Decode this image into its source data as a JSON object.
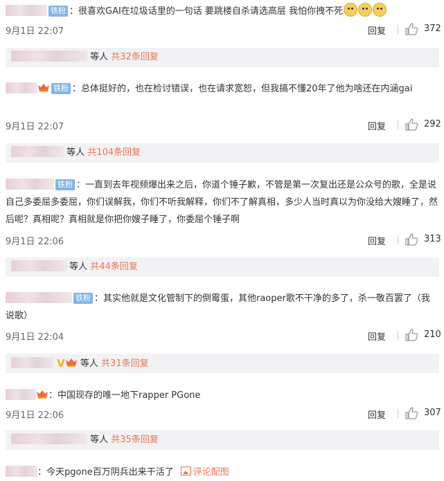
{
  "comments": [
    {
      "badge": "铁粉",
      "text": "：很喜欢GAI在垃圾话里的一句话 要跳楼自杀请选高层 我怕你拽不死",
      "time": "9月1日 22:07",
      "reply": "回复",
      "likes": "372",
      "emoji_icon": "doge-emoji-icon"
    },
    {
      "badge": "铁粉",
      "text": "：总体挺好的，也在检讨错误，也在请求宽恕，但我搞不懂20年了他为啥还在内涵gai",
      "time": "9月1日 22:07",
      "reply": "回复",
      "likes": "292"
    },
    {
      "badge": "铁粉",
      "text": "：一直到去年视频爆出来之后，你道个锤子歉，不管是第一次复出还是公众号的歌，全是说自己多委屈多委屈，你们误解我，你们不听我解释，你们不了解真相，多少人当时真以为你没给大嫂睡了，然后呢？真相呢？真相就是你把你嫂子睡了，你委屈个锤子啊",
      "time": "9月1日 22:06",
      "reply": "回复",
      "likes": "313"
    },
    {
      "badge": "铁粉",
      "text": "：其实他就是文化管制下的倒霉蛋，其他raoper歌不干净的多了，杀一敬百罢了（我说歌）",
      "time": "9月1日 22:04",
      "reply": "回复",
      "likes": "210"
    },
    {
      "text": "：中国现存的唯一地下rapper PGone",
      "time": "9月1日 22:06",
      "reply": "回复",
      "likes": "307"
    },
    {
      "text": "：今天pgone百万阴兵出来干活了",
      "pic_link": "评论配图"
    }
  ],
  "summaries": [
    {
      "suffix": "等人",
      "total": "共32条回复"
    },
    {
      "suffix": "等人",
      "total": "共104条回复"
    },
    {
      "suffix": "等人",
      "total": "共44条回复"
    },
    {
      "suffix": "等人",
      "total": "共31条回复",
      "verified": "V"
    },
    {
      "suffix": "等人",
      "total": "共35条回复"
    }
  ],
  "colors": {
    "accent": "#eb7350",
    "fan_badge": "#7fb6e8",
    "summary_bg": "#f2f2f5"
  }
}
